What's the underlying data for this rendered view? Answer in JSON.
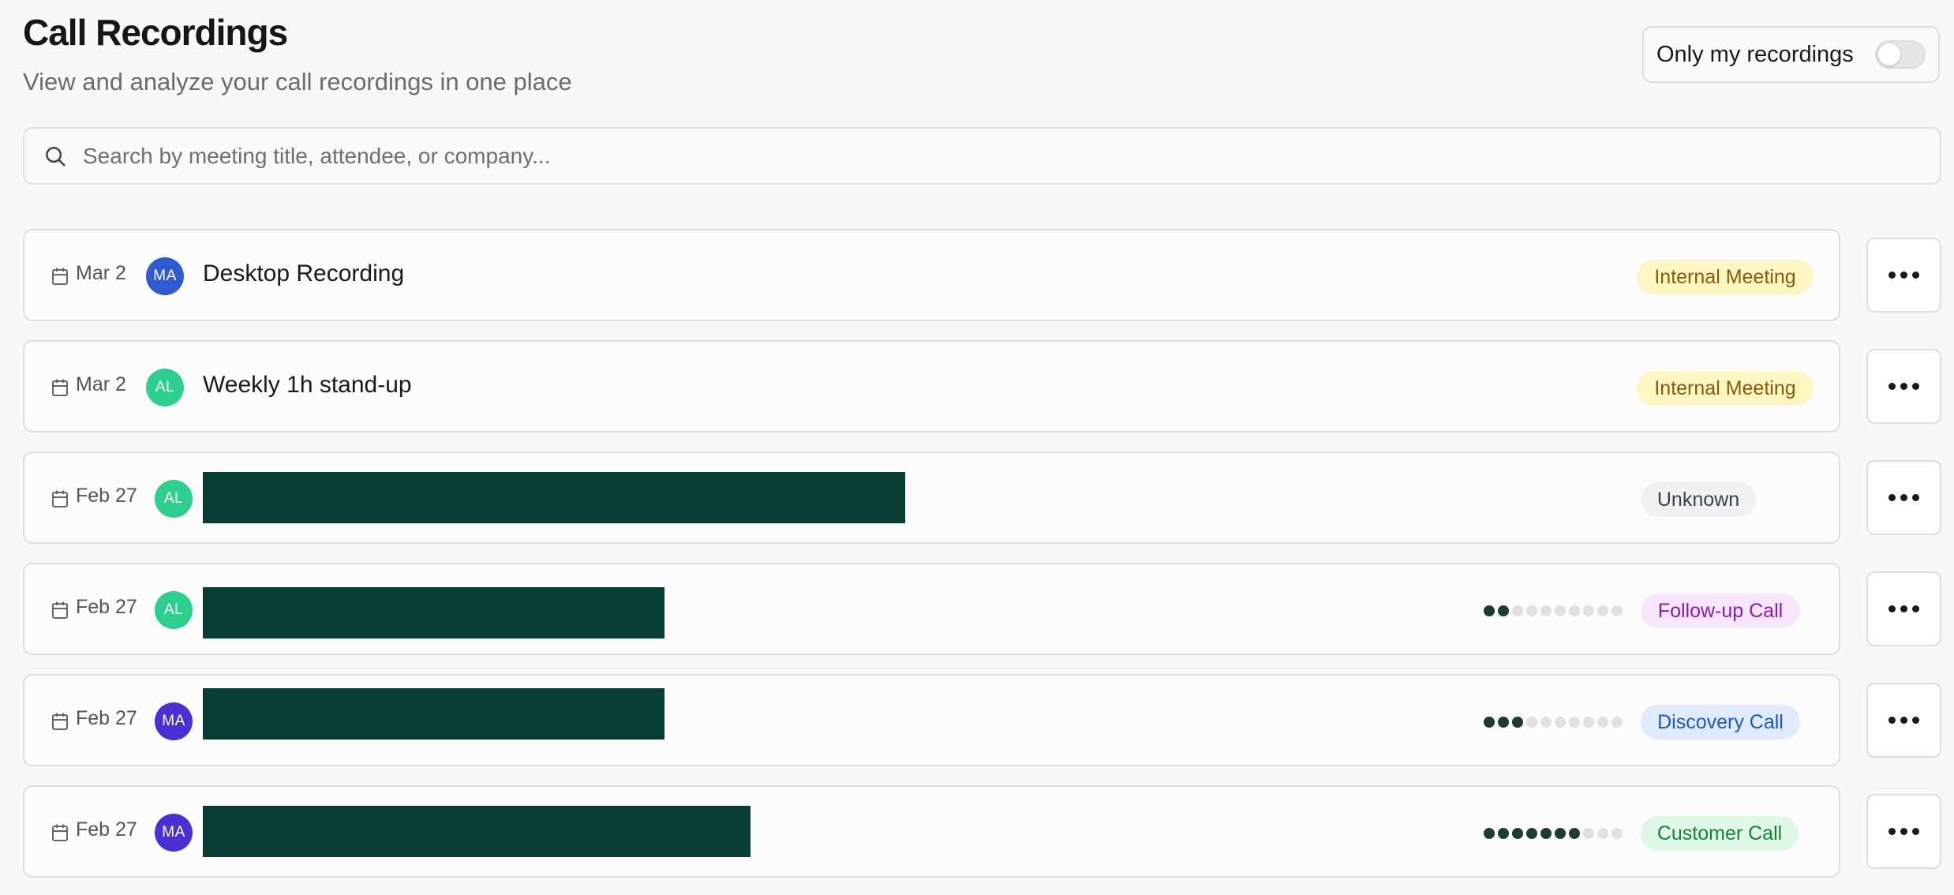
{
  "header": {
    "title": "Call Recordings",
    "subtitle": "View and analyze your call recordings in one place",
    "toggle_label": "Only my recordings",
    "toggle_on": false
  },
  "search": {
    "placeholder": "Search by meeting title, attendee, or company...",
    "value": "",
    "icon": "search-icon"
  },
  "recordings": [
    {
      "date": "Mar 2",
      "initials": "MA",
      "avatar_color": "#2f5bd0",
      "title": "Desktop Recording",
      "title_redacted": false,
      "tag": "Internal Meeting",
      "tag_bg": "#fdf6c3",
      "tag_color": "#8a5a0b",
      "score_level": null,
      "score_max": 10
    },
    {
      "date": "Mar 2",
      "initials": "AL",
      "avatar_color": "#2ecf8e",
      "title": "Weekly 1h stand-up",
      "title_redacted": false,
      "tag": "Internal Meeting",
      "tag_bg": "#fdf6c3",
      "tag_color": "#8a5a0b",
      "score_level": null,
      "score_max": 10
    },
    {
      "date": "Feb 27",
      "initials": "AL",
      "avatar_color": "#2ecf8e",
      "title": "",
      "title_redacted": true,
      "tag": "Unknown",
      "tag_bg": "#f0f1f3",
      "tag_color": "#3c4147",
      "score_level": null,
      "score_max": 10
    },
    {
      "date": "Feb 27",
      "initials": "AL",
      "avatar_color": "#2ecf8e",
      "title": "",
      "title_redacted": true,
      "tag": "Follow-up Call",
      "tag_bg": "#f7e6fb",
      "tag_color": "#8a19b8",
      "score_level": 2,
      "score_max": 10
    },
    {
      "date": "Feb 27",
      "initials": "MA",
      "avatar_color": "#4b2fd3",
      "title": "",
      "title_redacted": true,
      "tag": "Discovery Call",
      "tag_bg": "#e0ecfd",
      "tag_color": "#1f55c9",
      "score_level": 3,
      "score_max": 10
    },
    {
      "date": "Feb 27",
      "initials": "MA",
      "avatar_color": "#4b2fd3",
      "title": "",
      "title_redacted": true,
      "tag": "Customer Call",
      "tag_bg": "#dff7e6",
      "tag_color": "#17803d",
      "score_level": 7,
      "score_max": 10
    }
  ],
  "row_actions_icon": "more-horizontal-icon",
  "row_date_icon": "calendar-icon"
}
